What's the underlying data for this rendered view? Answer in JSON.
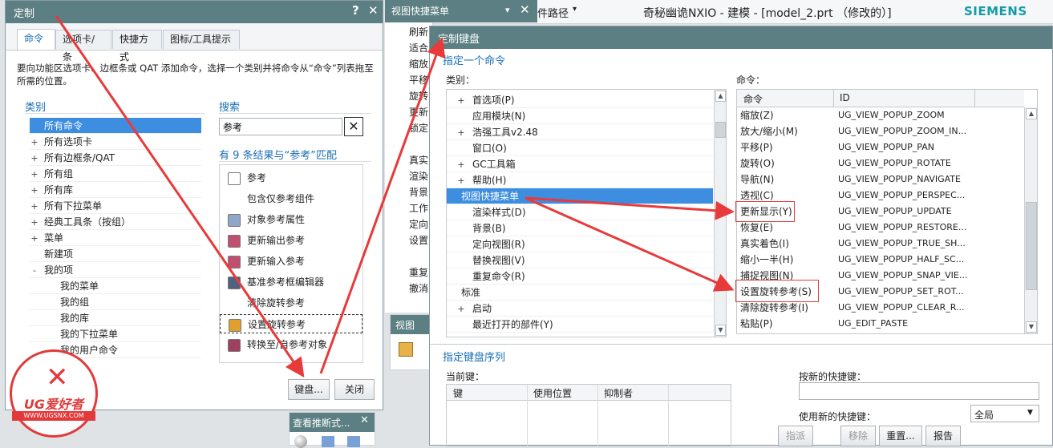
{
  "nx_title": "奇秘幽诡NXIO - 建模 - [model_2.prt （修改的）]",
  "brand": "SIEMENS",
  "path_label": "件路径",
  "customize": {
    "title": "定制",
    "help_btn": "?",
    "close_btn": "✕",
    "tabs": [
      "命令",
      "选项卡/条",
      "快捷方式",
      "图标/工具提示"
    ],
    "instruction": "要向功能区选项卡、边框条或 QAT 添加命令，选择一个类别并将命令从“命令”列表拖至所需的位置。",
    "category_header": "类别",
    "categories": [
      {
        "label": "所有命令",
        "indent": 0,
        "toggle": ""
      },
      {
        "label": "所有选项卡",
        "indent": 0,
        "toggle": "+"
      },
      {
        "label": "所有边框条/QAT",
        "indent": 0,
        "toggle": "+"
      },
      {
        "label": "所有组",
        "indent": 0,
        "toggle": "+"
      },
      {
        "label": "所有库",
        "indent": 0,
        "toggle": "+"
      },
      {
        "label": "所有下拉菜单",
        "indent": 0,
        "toggle": "+"
      },
      {
        "label": "经典工具条（按组）",
        "indent": 0,
        "toggle": "+"
      },
      {
        "label": "菜单",
        "indent": 0,
        "toggle": "+"
      },
      {
        "label": "新建项",
        "indent": 0,
        "toggle": ""
      },
      {
        "label": "我的项",
        "indent": 0,
        "toggle": "-"
      },
      {
        "label": "我的菜单",
        "indent": 1,
        "toggle": ""
      },
      {
        "label": "我的组",
        "indent": 1,
        "toggle": ""
      },
      {
        "label": "我的库",
        "indent": 1,
        "toggle": ""
      },
      {
        "label": "我的下拉菜单",
        "indent": 1,
        "toggle": ""
      },
      {
        "label": "我的用户命令",
        "indent": 1,
        "toggle": ""
      }
    ],
    "search_header": "搜索",
    "search_value": "参考",
    "clear_btn": "✕",
    "results_header": "有 9 条结果与“参考”匹配",
    "results": [
      {
        "label": "参考",
        "icon": "value-icon"
      },
      {
        "label": "包含仅参考组件",
        "icon": ""
      },
      {
        "label": "对象参考属性",
        "icon": "object-property-icon"
      },
      {
        "label": "更新输出参考",
        "icon": "update-output-icon"
      },
      {
        "label": "更新输入参考",
        "icon": "update-input-icon"
      },
      {
        "label": "基准参考框编辑器",
        "icon": "datum-editor-icon"
      },
      {
        "label": "清除旋转参考",
        "icon": ""
      },
      {
        "label": "设置旋转参考",
        "icon": "set-rotate-icon"
      },
      {
        "label": "转换至/自参考对象",
        "icon": "convert-icon"
      }
    ],
    "keyboard_btn": "键盘...",
    "close_label": "关闭"
  },
  "popup_menu": {
    "title": "视图快捷菜单",
    "dropdown": "▾",
    "close_btn": "✕",
    "items": [
      "刷新",
      "适合",
      "缩放",
      "平移",
      "旋转",
      "更新",
      "锁定",
      "",
      "真实",
      "渲染",
      "背景",
      "工作",
      "定向",
      "设置",
      "",
      "重复",
      "撤消"
    ]
  },
  "view_panel": {
    "title": "视图"
  },
  "infer_panel": {
    "title": "查看推断式...",
    "close_btn": "✕"
  },
  "keyboard": {
    "title": "定制键盘",
    "specify_cmd": "指定一个命令",
    "category_label": "类别：",
    "command_label": "命令：",
    "categories": [
      {
        "label": "首选项(P)",
        "indent": 1,
        "toggle": "+"
      },
      {
        "label": "应用模块(N)",
        "indent": 1,
        "toggle": ""
      },
      {
        "label": "浩强工具v2.48",
        "indent": 1,
        "toggle": "+"
      },
      {
        "label": "窗口(O)",
        "indent": 1,
        "toggle": ""
      },
      {
        "label": "GC工具箱",
        "indent": 1,
        "toggle": "+"
      },
      {
        "label": "帮助(H)",
        "indent": 1,
        "toggle": "+"
      },
      {
        "label": "视图快捷菜单",
        "indent": 0,
        "toggle": ""
      },
      {
        "label": "渲染样式(D)",
        "indent": 1,
        "toggle": ""
      },
      {
        "label": "背景(B)",
        "indent": 1,
        "toggle": ""
      },
      {
        "label": "定向视图(R)",
        "indent": 1,
        "toggle": ""
      },
      {
        "label": "替换视图(V)",
        "indent": 1,
        "toggle": ""
      },
      {
        "label": "重复命令(R)",
        "indent": 1,
        "toggle": ""
      },
      {
        "label": "标准",
        "indent": 0,
        "toggle": ""
      },
      {
        "label": "启动",
        "indent": 1,
        "toggle": "+"
      },
      {
        "label": "最近打开的部件(Y)",
        "indent": 1,
        "toggle": ""
      }
    ],
    "col_command": "命令",
    "col_id": "ID",
    "commands": [
      {
        "name": "缩放(Z)",
        "id": "UG_VIEW_POPUP_ZOOM"
      },
      {
        "name": "放大/缩小(M)",
        "id": "UG_VIEW_POPUP_ZOOM_IN..."
      },
      {
        "name": "平移(P)",
        "id": "UG_VIEW_POPUP_PAN"
      },
      {
        "name": "旋转(O)",
        "id": "UG_VIEW_POPUP_ROTATE"
      },
      {
        "name": "导航(N)",
        "id": "UG_VIEW_POPUP_NAVIGATE"
      },
      {
        "name": "透视(C)",
        "id": "UG_VIEW_POPUP_PERSPEC..."
      },
      {
        "name": "更新显示(Y)",
        "id": "UG_VIEW_POPUP_UPDATE"
      },
      {
        "name": "恢复(E)",
        "id": "UG_VIEW_POPUP_RESTORE..."
      },
      {
        "name": "真实着色(I)",
        "id": "UG_VIEW_POPUP_TRUE_SH..."
      },
      {
        "name": "缩小一半(H)",
        "id": "UG_VIEW_POPUP_HALF_SC..."
      },
      {
        "name": "捕捉视图(N)",
        "id": "UG_VIEW_POPUP_SNAP_VIE..."
      },
      {
        "name": "设置旋转参考(S)",
        "id": "UG_VIEW_POPUP_SET_ROT..."
      },
      {
        "name": "清除旋转参考(I)",
        "id": "UG_VIEW_POPUP_CLEAR_R..."
      },
      {
        "name": "粘贴(P)",
        "id": "UG_EDIT_PASTE"
      }
    ],
    "specify_seq": "指定键盘序列",
    "current_key_label": "当前键：",
    "key_cols": [
      "键",
      "使用位置",
      "抑制者"
    ],
    "new_key_label": "按新的快捷键：",
    "use_new_label": "使用新的快捷键：",
    "scope_value": "全局",
    "assign_btn": "指派",
    "remove_btn": "移除",
    "reset_btn": "重置...",
    "report_btn": "报告"
  },
  "watermark": {
    "text": "UG爱好者",
    "url": "WWW.UGSNX.COM"
  }
}
